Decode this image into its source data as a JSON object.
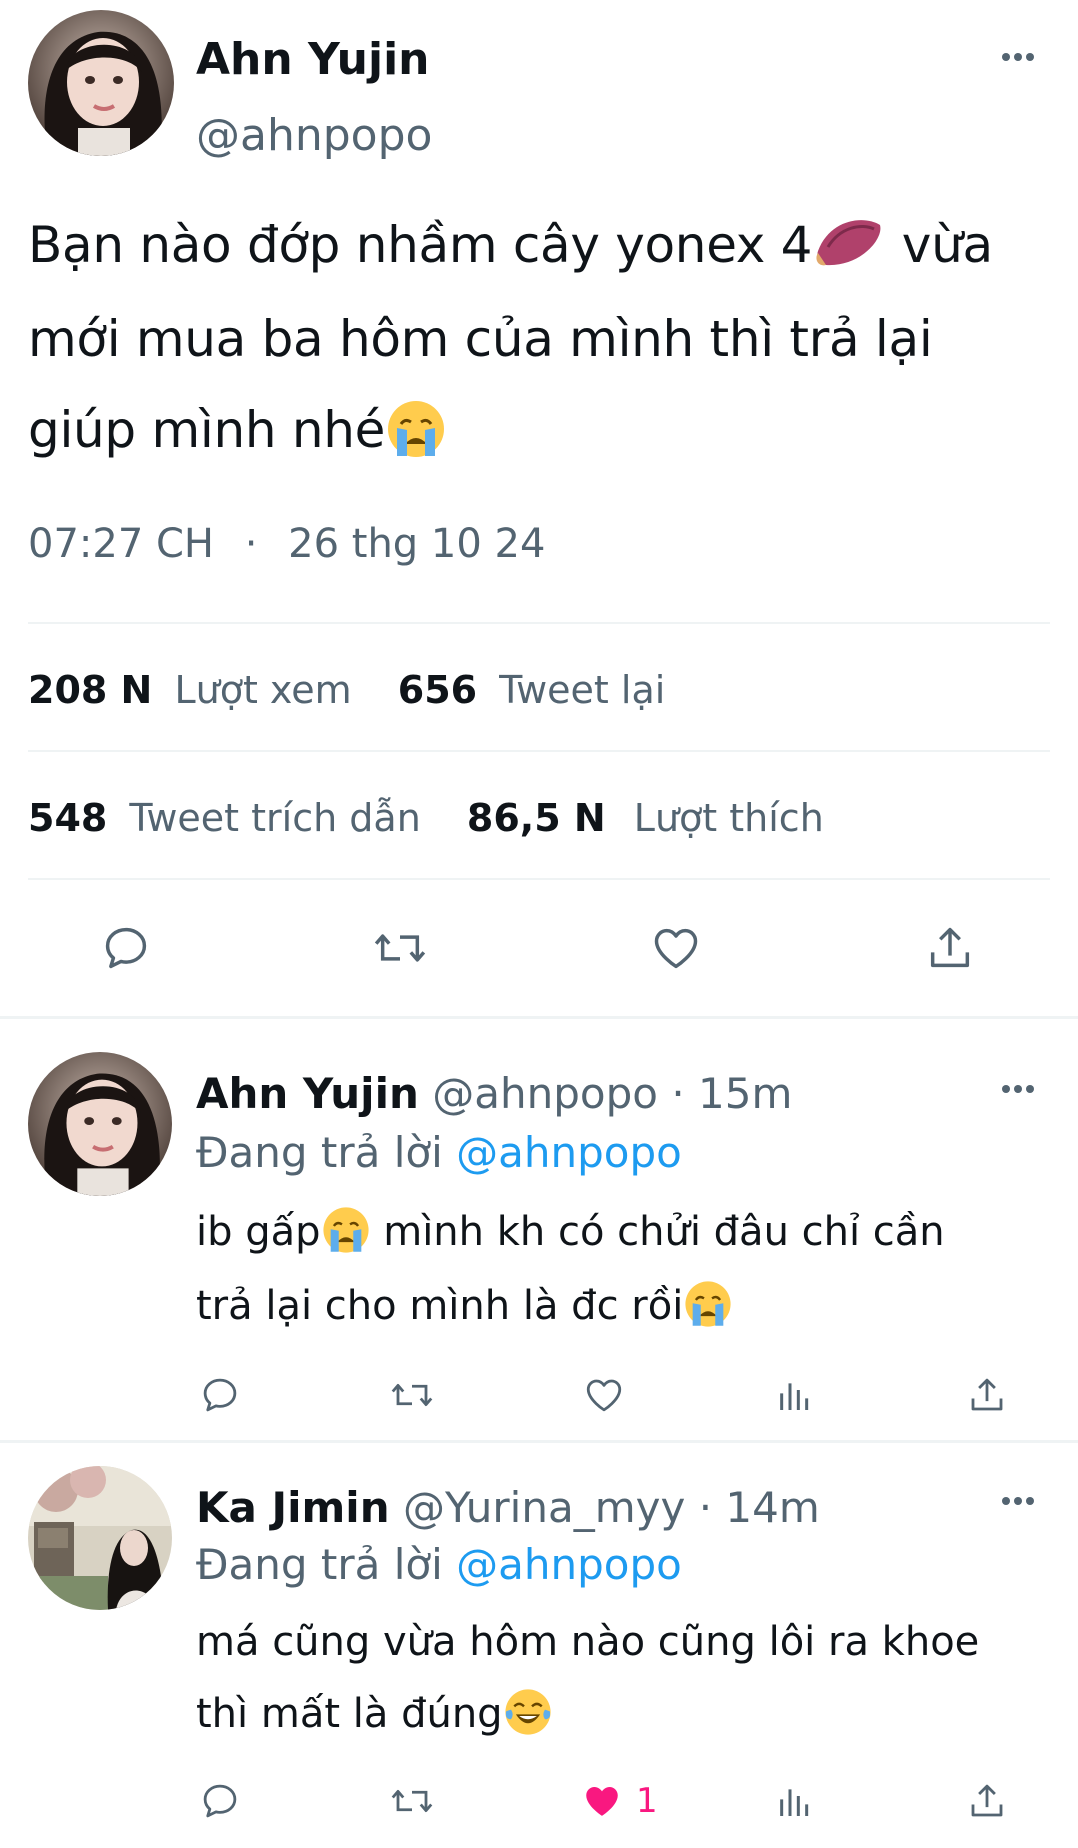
{
  "main_tweet": {
    "author_name": "Ahn Yujin",
    "author_handle": "@ahnpopo",
    "text_line1": "Bạn nào đớp nhầm cây yonex 4",
    "text_line1_end": " vừa",
    "text_line2": "mới mua ba hôm của mình thì trả lại",
    "text_line3": "giúp mình nhé",
    "time": "07:27 CH",
    "date": "26 thg 10 24",
    "stats": {
      "views_count": "208 N",
      "views_label": "Lượt xem",
      "retweets_count": "656",
      "retweets_label": "Tweet lại",
      "quotes_count": "548",
      "quotes_label": "Tweet trích dẫn",
      "likes_count": "86,5 N",
      "likes_label": "Lượt thích"
    }
  },
  "replies": [
    {
      "author_name": "Ahn Yujin",
      "author_handle": "@ahnpopo",
      "time": "· 15m",
      "replying_prefix": "Đang trả lời",
      "replying_to": "@ahnpopo",
      "text_line1_a": "ib gấp",
      "text_line1_b": " mình kh có chửi đâu chỉ cần",
      "text_line2": "trả lại cho mình là đc rồi"
    },
    {
      "author_name": "Ka Jimin",
      "author_handle": "@Yurina_myy",
      "time": "· 14m",
      "replying_prefix": "Đang trả lời",
      "replying_to": "@ahnpopo",
      "text_line1": "má cũng vừa hôm nào cũng lôi ra khoe",
      "text_line2": "thì mất là đúng",
      "like_count": "1"
    }
  ],
  "icons": {
    "reply": "reply-icon",
    "retweet": "retweet-icon",
    "like": "heart-icon",
    "views": "analytics-icon",
    "share": "share-icon",
    "more": "more-icon"
  },
  "colors": {
    "link": "#1d9bf0",
    "muted": "#536471",
    "like_active": "#f91880"
  }
}
